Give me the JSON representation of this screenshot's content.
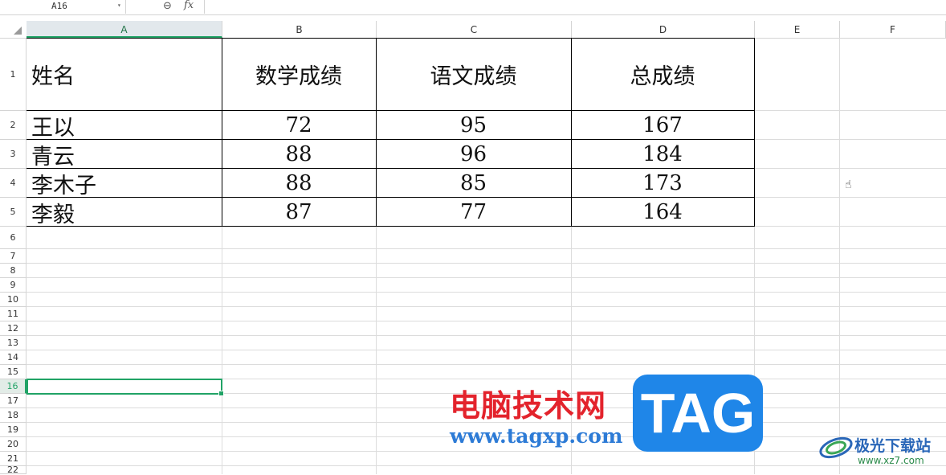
{
  "formula_bar": {
    "name_box": "A16",
    "zoom_icon": "zoom-out-icon",
    "fx_label": "fx",
    "formula_value": ""
  },
  "columns": [
    "A",
    "B",
    "C",
    "D",
    "E",
    "F"
  ],
  "active_column": "A",
  "rows": [
    "1",
    "2",
    "3",
    "4",
    "5",
    "6",
    "7",
    "8",
    "9",
    "10",
    "11",
    "12",
    "13",
    "14",
    "15",
    "16",
    "17",
    "18",
    "19",
    "20",
    "21",
    "22"
  ],
  "active_row": "16",
  "table": {
    "headers": [
      "姓名",
      "数学成绩",
      "语文成绩",
      "总成绩"
    ],
    "rows": [
      [
        "王以",
        "72",
        "95",
        "167"
      ],
      [
        "青云",
        "88",
        "96",
        "184"
      ],
      [
        "李木子",
        "88",
        "85",
        "173"
      ],
      [
        "李毅",
        "87",
        "77",
        "164"
      ]
    ]
  },
  "watermark": {
    "site_name": "电脑技术网",
    "site_url": "www.tagxp.com",
    "tag_logo": "TAG",
    "site2_name": "极光下载站",
    "site2_url": "www.xz7.com"
  },
  "colors": {
    "accent": "#21a366",
    "watermark_red": "#e3232c",
    "watermark_blue": "#1f86e8"
  }
}
